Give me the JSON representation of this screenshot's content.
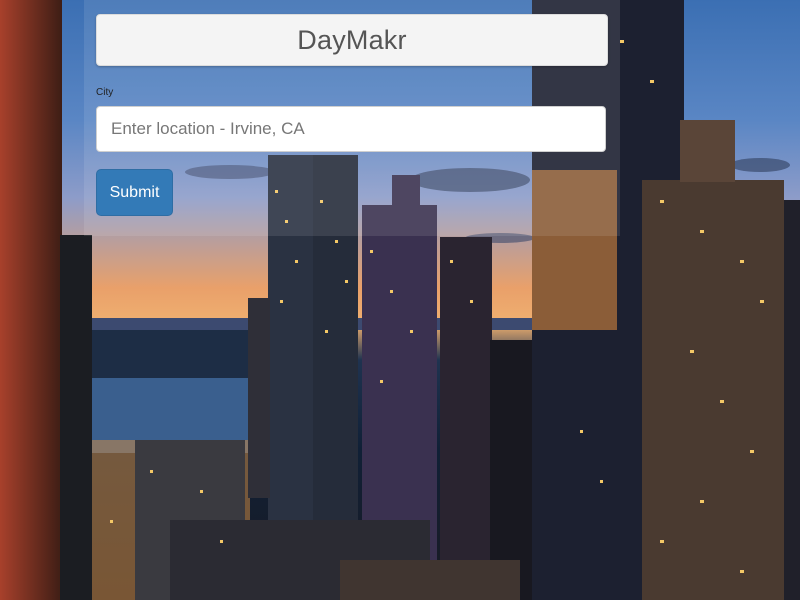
{
  "app": {
    "title": "DayMakr"
  },
  "form": {
    "city_label": "City",
    "city_input": {
      "value": "",
      "placeholder": "Enter location - Irvine, CA"
    },
    "submit_label": "Submit"
  },
  "colors": {
    "primary_button": "#337ab7"
  }
}
